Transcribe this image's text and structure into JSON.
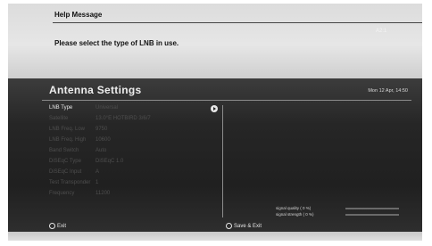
{
  "help": {
    "title": "Help Message",
    "message": "Please select the type of LNB in use.",
    "faint_text": "A2:1"
  },
  "panel": {
    "title": "Antenna Settings",
    "datetime": "Mon 12 Apr, 14:50",
    "rows": [
      {
        "label": "LNB Type",
        "value": "Universal",
        "active": true
      },
      {
        "label": "Satellite",
        "value": "13.0°E HOTBIRD 3/6/7",
        "active": false
      },
      {
        "label": "LNB Freq. Low",
        "value": "9750",
        "active": false
      },
      {
        "label": "LNB Freq. High",
        "value": "10600",
        "active": false
      },
      {
        "label": "Band Switch",
        "value": "Auto",
        "active": false
      },
      {
        "label": "DiSEqC Type",
        "value": "DiSEqC 1.0",
        "active": false
      },
      {
        "label": "DiSEqC Input",
        "value": "A",
        "active": false
      },
      {
        "label": "Test Transponder",
        "value": "1",
        "active": false
      },
      {
        "label": "Frequency",
        "value": "11200",
        "active": false
      }
    ]
  },
  "signal": {
    "quality_label": "signal quality ( 0 %)",
    "strength_label": "signal strength ( 0 %)",
    "quality_value": 0,
    "strength_value": 0
  },
  "footer": {
    "exit_label": "Exit",
    "save_label": "Save & Exit"
  },
  "colors": {
    "help_bg": "#e2e2e2",
    "panel_bg": "#262626",
    "text_light": "#e6e6e6",
    "text_dim": "#4e4e4e"
  },
  "icons": {
    "arrow": "right-arrow-icon",
    "exit": "circle-button-icon",
    "save": "circle-button-icon"
  }
}
